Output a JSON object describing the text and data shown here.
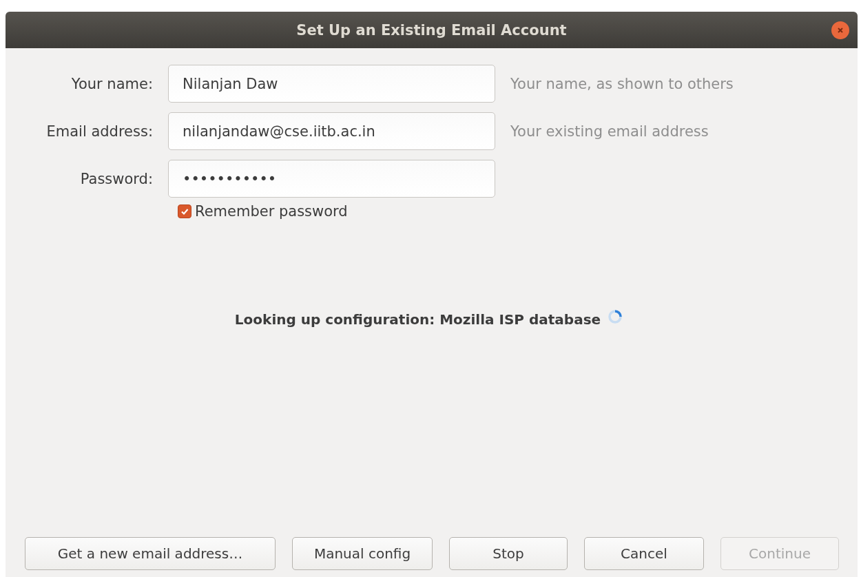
{
  "window": {
    "title": "Set Up an Existing Email Account"
  },
  "fields": [
    {
      "label": "Your name:",
      "value": "Nilanjan Daw",
      "hint": "Your name, as shown to others"
    },
    {
      "label": "Email address:",
      "value": "nilanjandaw@cse.iitb.ac.in",
      "hint": "Your existing email address"
    },
    {
      "label": "Password:",
      "value": "•••••••••••"
    }
  ],
  "remember_password": {
    "label": "Remember password",
    "checked": true
  },
  "status": {
    "text": "Looking up configuration: Mozilla ISP database",
    "busy": true
  },
  "buttons": [
    {
      "label": "Get a new email address…",
      "disabled": false
    },
    {
      "label": "Manual config",
      "disabled": false
    },
    {
      "label": "Stop",
      "disabled": false
    },
    {
      "label": "Cancel",
      "disabled": false
    },
    {
      "label": "Continue",
      "disabled": true
    }
  ]
}
